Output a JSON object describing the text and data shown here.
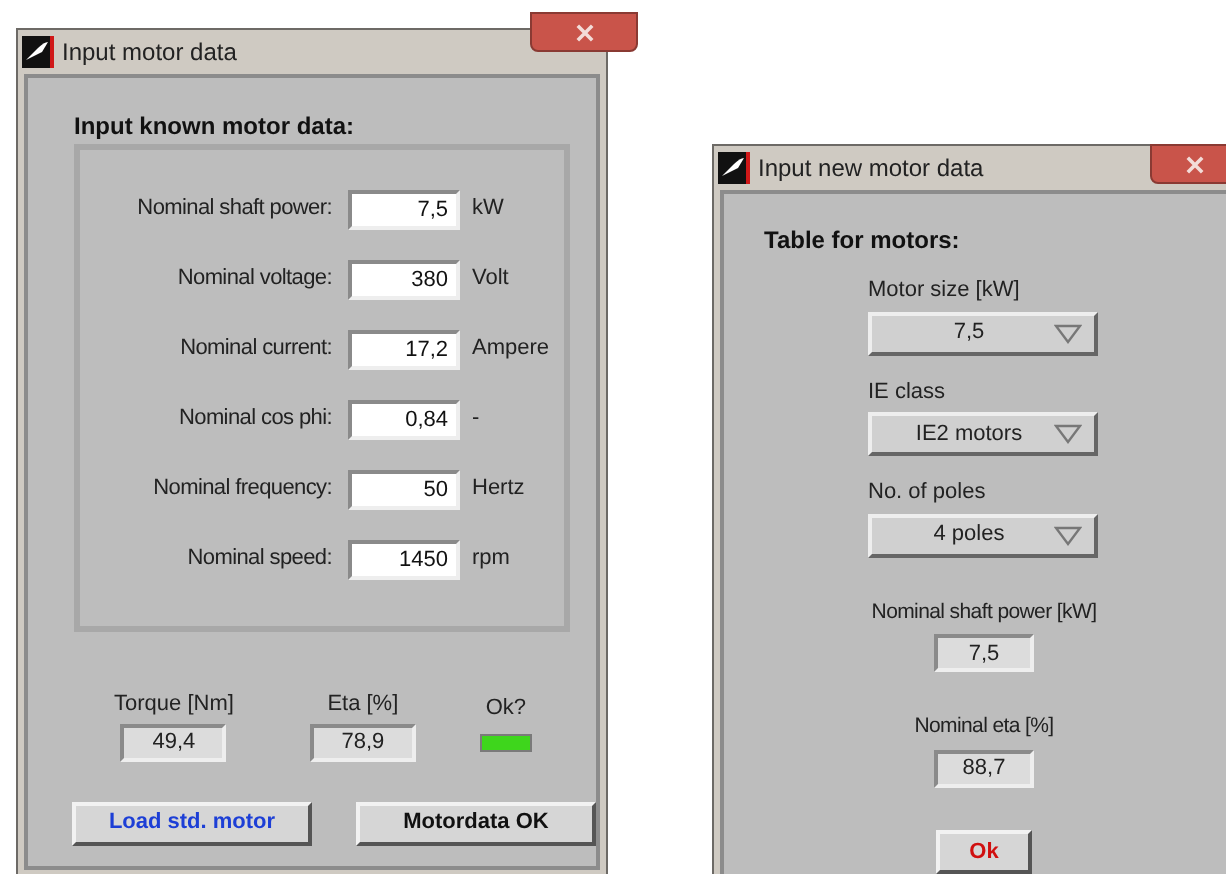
{
  "windows": [
    {
      "title": "Input motor data",
      "heading": "Input known motor data:",
      "fields": [
        {
          "label": "Nominal shaft power:",
          "value": "7,5",
          "unit": "kW"
        },
        {
          "label": "Nominal voltage:",
          "value": "380",
          "unit": "Volt"
        },
        {
          "label": "Nominal current:",
          "value": "17,2",
          "unit": "Ampere"
        },
        {
          "label": "Nominal cos phi:",
          "value": "0,84",
          "unit": "-"
        },
        {
          "label": "Nominal frequency:",
          "value": "50",
          "unit": "Hertz"
        },
        {
          "label": "Nominal speed:",
          "value": "1450",
          "unit": "rpm"
        }
      ],
      "results": [
        {
          "label": "Torque [Nm]",
          "value": "49,4"
        },
        {
          "label": "Eta [%]",
          "value": "78,9"
        }
      ],
      "indicator": {
        "label": "Ok?",
        "on": true
      },
      "buttons": [
        {
          "label": "Load std. motor",
          "kind": "primary"
        },
        {
          "label": "Motordata OK",
          "kind": "plain"
        }
      ]
    },
    {
      "title": "Input new motor data",
      "heading": "Table for motors:",
      "dropdowns": [
        {
          "label": "Motor size [kW]",
          "value": "7,5"
        },
        {
          "label": "IE class",
          "value": "IE2 motors"
        },
        {
          "label": "No. of poles",
          "value": "4 poles"
        }
      ],
      "outputs": [
        {
          "label": "Nominal shaft power [kW]",
          "value": "7,5"
        },
        {
          "label": "Nominal eta [%]",
          "value": "88,7"
        }
      ],
      "buttons": [
        {
          "label": "Ok",
          "kind": "danger"
        }
      ]
    }
  ]
}
